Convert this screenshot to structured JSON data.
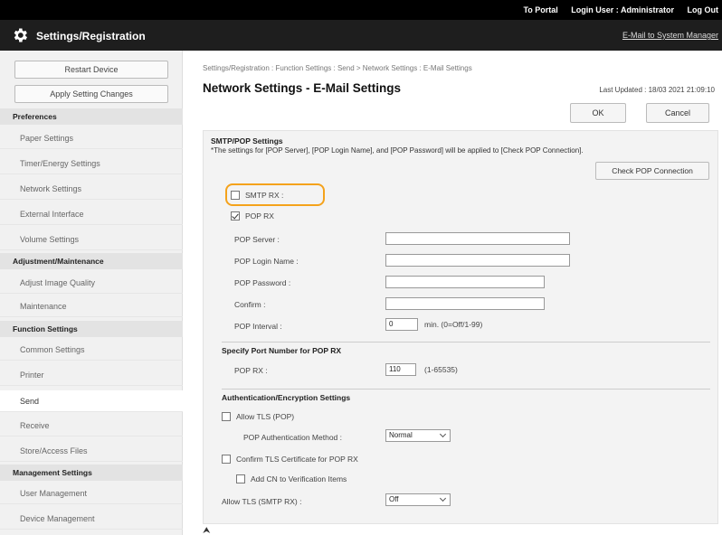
{
  "topbar": {
    "to_portal": "To Portal",
    "login_user": "Login User : Administrator",
    "logout": "Log Out"
  },
  "header": {
    "title": "Settings/Registration",
    "email_link": "E-Mail to System Manager"
  },
  "sidebar": {
    "restart": "Restart Device",
    "apply": "Apply Setting Changes",
    "sections": {
      "preferences": "Preferences",
      "adjustment": "Adjustment/Maintenance",
      "function": "Function Settings",
      "management": "Management Settings"
    },
    "items": {
      "paper": "Paper Settings",
      "timer": "Timer/Energy Settings",
      "network": "Network Settings",
      "external": "External Interface",
      "volume": "Volume Settings",
      "adjust_image": "Adjust Image Quality",
      "maintenance": "Maintenance",
      "common": "Common Settings",
      "printer": "Printer",
      "send": "Send",
      "receive": "Receive",
      "store": "Store/Access Files",
      "user_mgmt": "User Management",
      "device_mgmt": "Device Management"
    }
  },
  "main": {
    "breadcrumb": "Settings/Registration : Function Settings : Send > Network Settings : E-Mail Settings",
    "title": "Network Settings - E-Mail Settings",
    "last_updated": "Last Updated : 18/03 2021 21:09:10",
    "ok": "OK",
    "cancel": "Cancel"
  },
  "smtp_pop": {
    "title": "SMTP/POP Settings",
    "note": "*The settings for [POP Server], [POP Login Name], and [POP Password] will be applied to [Check POP Connection].",
    "check_button": "Check POP Connection",
    "smtp_rx": "SMTP RX :",
    "pop_rx": "POP RX",
    "pop_server_label": "POP Server :",
    "pop_server_value": "",
    "pop_login_label": "POP Login Name :",
    "pop_login_value": "",
    "pop_password_label": "POP Password :",
    "pop_password_value": "",
    "confirm_label": "Confirm :",
    "confirm_value": "",
    "pop_interval_label": "POP Interval :",
    "pop_interval_value": "0",
    "pop_interval_hint": "min. (0=Off/1-99)"
  },
  "port": {
    "title": "Specify Port Number for POP RX",
    "label": "POP RX :",
    "value": "110",
    "hint": "(1-65535)"
  },
  "auth": {
    "title": "Authentication/Encryption Settings",
    "allow_tls_pop": "Allow TLS (POP)",
    "pop_auth_label": "POP Authentication Method :",
    "pop_auth_value": "Normal",
    "confirm_tls": "Confirm TLS Certificate for POP RX",
    "add_cn": "Add CN to Verification Items",
    "allow_tls_smtp_label": "Allow TLS (SMTP RX) :",
    "allow_tls_smtp_value": "Off"
  },
  "footer": {
    "to_top": "⮝"
  }
}
